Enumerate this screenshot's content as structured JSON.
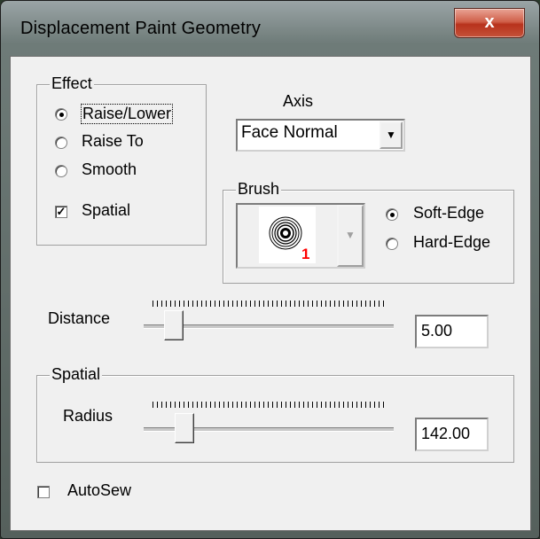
{
  "window": {
    "title": "Displacement Paint Geometry",
    "close_icon": "close-icon",
    "close_glyph": "x"
  },
  "effect": {
    "group_label": "Effect",
    "options": [
      "Raise/Lower",
      "Raise To",
      "Smooth"
    ],
    "selected": "Raise/Lower",
    "spatial_label": "Spatial",
    "spatial_checked": true,
    "check_glyph": "✓"
  },
  "axis": {
    "label": "Axis",
    "value": "Face Normal",
    "dropdown_icon": "chevron-down-icon",
    "dropdown_glyph": "▼"
  },
  "brush": {
    "group_label": "Brush",
    "brush_number": "1",
    "options": [
      "Soft-Edge",
      "Hard-Edge"
    ],
    "selected": "Soft-Edge",
    "dropdown_glyph": "▼"
  },
  "distance": {
    "label": "Distance",
    "value": "5.00"
  },
  "spatial": {
    "group_label": "Spatial",
    "radius_label": "Radius",
    "radius_value": "142.00"
  },
  "autosew": {
    "label": "AutoSew",
    "checked": false
  },
  "colors": {
    "brush_number": "#ff0000",
    "close_button": "#c5523a"
  }
}
